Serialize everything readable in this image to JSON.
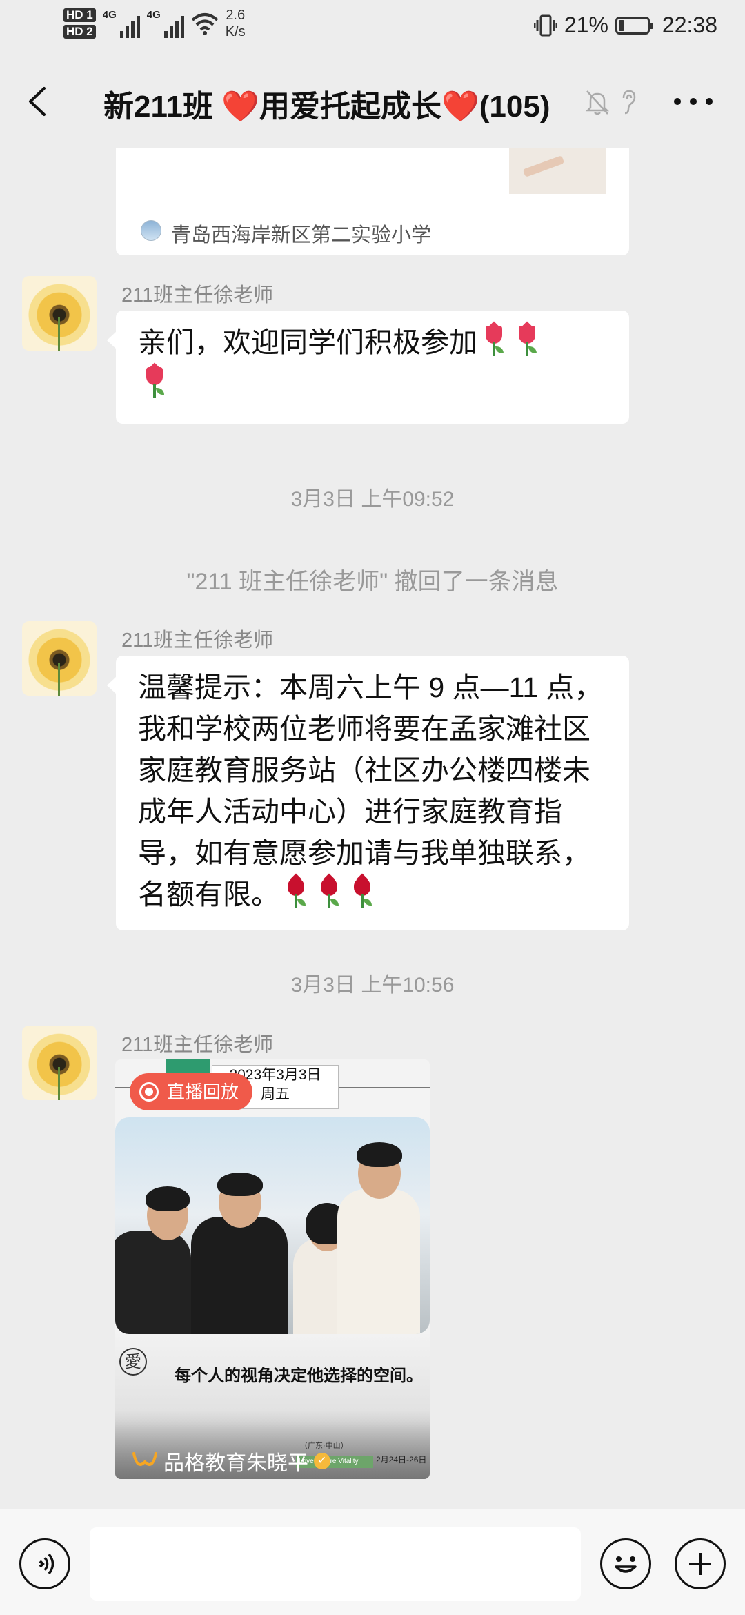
{
  "status_bar": {
    "hd1": "HD 1",
    "hd2": "HD 2",
    "net1": "4G",
    "net2": "4G",
    "speed_value": "2.6",
    "speed_unit": "K/s",
    "battery": "21%",
    "battery_level": 0.21,
    "time": "22:38"
  },
  "chat": {
    "title": "新211班 ❤️用爱托起成长❤️(105)"
  },
  "messages": {
    "card_source": "青岛西海岸新区第二实验小学",
    "sender1": "211班主任徐老师",
    "text1": "亲们，欢迎同学们积极参加",
    "time1": "3月3日 上午09:52",
    "recall_notice": "\"211 班主任徐老师\" 撤回了一条消息",
    "sender2": "211班主任徐老师",
    "text2": "温馨提示：本周六上午 9 点—11 点，我和学校两位老师将要在孟家滩社区家庭教育服务站（社区办公楼四楼未成年人活动中心）进行家庭教育指导，如有意愿参加请与我单独联系，名额有限。",
    "time2": "3月3日 上午10:56",
    "sender3": "211班主任徐老师"
  },
  "video_card": {
    "badge": "直播回放",
    "date_line1": "2023年3月3日",
    "date_line2": "周五",
    "logo_char": "愛",
    "slogan": "每个人的视角决定他选择的空间。",
    "green_tag": "Love Nature Vitality",
    "dates": "2月24日-26日",
    "small_caption": "（广东·中山）",
    "channel": "品格教育朱晓平"
  },
  "input": {
    "placeholder": ""
  },
  "colors": {
    "background": "#ededed",
    "bubble": "#ffffff",
    "live_badge": "#f05a4a",
    "muted_text": "#999999"
  }
}
